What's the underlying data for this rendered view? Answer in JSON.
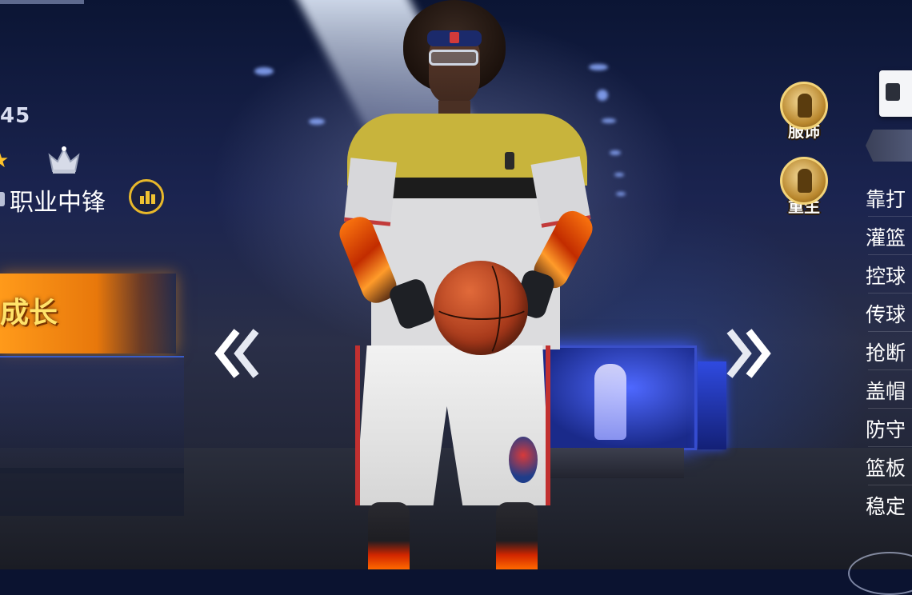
{
  "player_card": {
    "number": "45",
    "position": "职业中锋",
    "growth_button": "成长"
  },
  "side_buttons": {
    "outfit": "服饰",
    "reborn": "重生"
  },
  "stats": [
    {
      "label": "靠打"
    },
    {
      "label": "灌篮"
    },
    {
      "label": "控球"
    },
    {
      "label": "传球"
    },
    {
      "label": "抢断"
    },
    {
      "label": "盖帽"
    },
    {
      "label": "防守"
    },
    {
      "label": "篮板"
    },
    {
      "label": "稳定"
    }
  ],
  "colors": {
    "accent_gold": "#f0c232",
    "growth_orange": "#ff9a1a",
    "background_navy": "#0b1330"
  },
  "icons": {
    "star": "star-icon",
    "crown": "crown-icon",
    "rating": "bar-chart-icon",
    "prev": "double-chevron-left-icon",
    "next": "double-chevron-right-icon"
  }
}
